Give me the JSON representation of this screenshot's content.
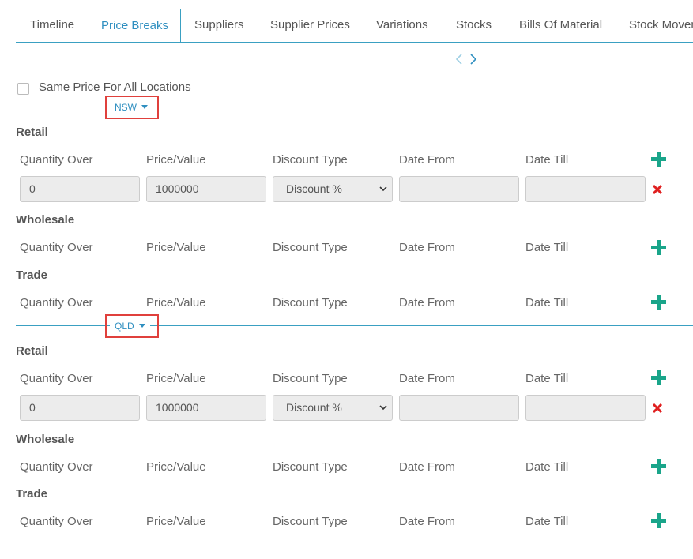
{
  "tabs": [
    {
      "label": "Timeline"
    },
    {
      "label": "Price Breaks"
    },
    {
      "label": "Suppliers"
    },
    {
      "label": "Supplier Prices"
    },
    {
      "label": "Variations"
    },
    {
      "label": "Stocks"
    },
    {
      "label": "Bills Of Material"
    },
    {
      "label": "Stock Mover"
    }
  ],
  "same_price_label": "Same Price For All Locations",
  "columns": {
    "quantity_over": "Quantity Over",
    "price_value": "Price/Value",
    "discount_type": "Discount Type",
    "date_from": "Date From",
    "date_till": "Date Till"
  },
  "locations": [
    {
      "name": "NSW",
      "sections": [
        {
          "title": "Retail",
          "row": {
            "quantity": "0",
            "price": "1000000",
            "discount_type": "Discount %",
            "date_from": "",
            "date_till": ""
          }
        },
        {
          "title": "Wholesale"
        },
        {
          "title": "Trade"
        }
      ]
    },
    {
      "name": "QLD",
      "sections": [
        {
          "title": "Retail",
          "row": {
            "quantity": "0",
            "price": "1000000",
            "discount_type": "Discount %",
            "date_from": "",
            "date_till": ""
          }
        },
        {
          "title": "Wholesale"
        },
        {
          "title": "Trade"
        }
      ]
    }
  ],
  "colors": {
    "accent": "#2f8fc0",
    "add": "#1aa58a",
    "remove": "#e02020",
    "highlight": "#e0403c"
  },
  "icons": {
    "add": "plus-icon",
    "remove": "close-icon",
    "prev": "chevron-left-icon",
    "next": "chevron-right-icon",
    "dropdown": "caret-down-icon"
  }
}
